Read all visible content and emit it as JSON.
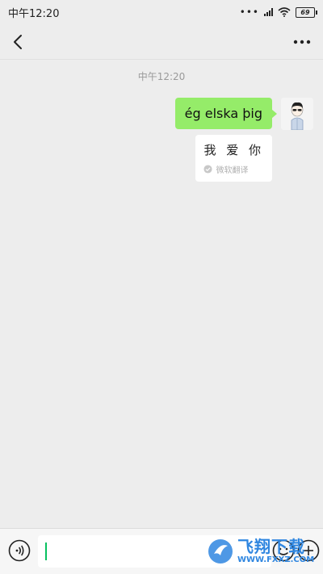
{
  "status_bar": {
    "time": "中午12:20",
    "battery": "69"
  },
  "nav": {
    "back_icon": "chevron-left-icon",
    "more_icon": "more-dots-icon"
  },
  "chat": {
    "timestamp": "中午12:20",
    "sent_message": "ég elska þig",
    "translation_text": "我 爱 你",
    "translation_source": "微软翻译",
    "bubble_color": "#95ec69"
  },
  "input": {
    "value": "",
    "cursor_color": "#07c160"
  },
  "watermark": {
    "title": "飞翔下载",
    "url": "WWW.FXXZ.COM"
  }
}
